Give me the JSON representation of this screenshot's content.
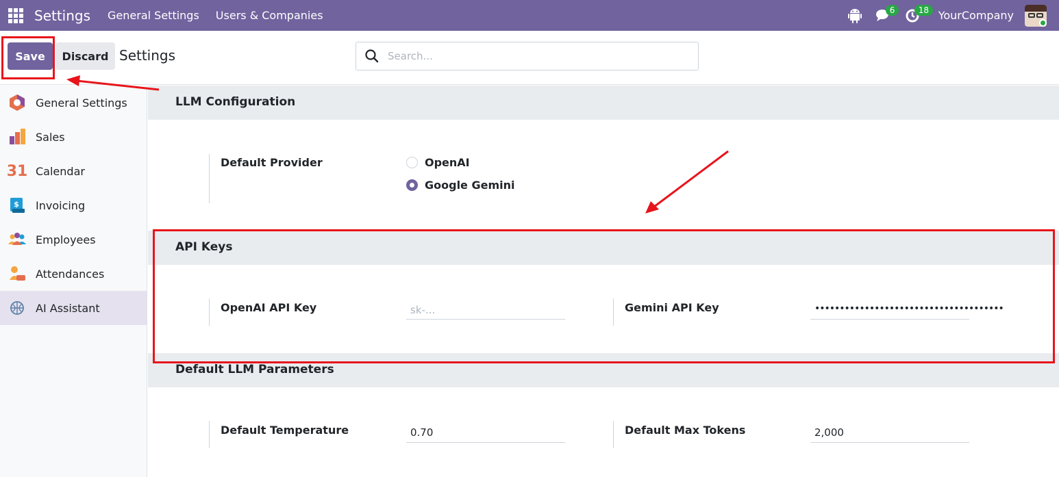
{
  "navbar": {
    "app_title": "Settings",
    "menu": [
      "General Settings",
      "Users & Companies"
    ],
    "messages_count": "6",
    "activities_count": "18",
    "company": "YourCompany"
  },
  "control_panel": {
    "save_label": "Save",
    "discard_label": "Discard",
    "title": "Settings",
    "search_placeholder": "Search..."
  },
  "sidebar": {
    "items": [
      {
        "label": "General Settings",
        "icon": "general-settings-icon"
      },
      {
        "label": "Sales",
        "icon": "sales-icon"
      },
      {
        "label": "Calendar",
        "icon": "calendar-icon"
      },
      {
        "label": "Invoicing",
        "icon": "invoicing-icon"
      },
      {
        "label": "Employees",
        "icon": "employees-icon"
      },
      {
        "label": "Attendances",
        "icon": "attendances-icon"
      },
      {
        "label": "AI Assistant",
        "icon": "ai-assistant-icon",
        "active": true
      }
    ],
    "calendar_icon_text": "31"
  },
  "sections": {
    "llm_config": {
      "title": "LLM Configuration",
      "provider_label": "Default Provider",
      "options": [
        {
          "label": "OpenAI",
          "selected": false
        },
        {
          "label": "Google Gemini",
          "selected": true
        }
      ]
    },
    "api_keys": {
      "title": "API Keys",
      "openai_label": "OpenAI API Key",
      "openai_value": "",
      "openai_placeholder": "sk-...",
      "gemini_label": "Gemini API Key",
      "gemini_value": "••••••••••••••••••••••••••••••••••••••"
    },
    "params": {
      "title": "Default LLM Parameters",
      "temperature_label": "Default Temperature",
      "temperature_value": "0.70",
      "max_tokens_label": "Default Max Tokens",
      "max_tokens_value": "2,000"
    }
  },
  "colors": {
    "brand": "#71639e",
    "annotation": "#e8141b",
    "badge": "#28a745"
  }
}
